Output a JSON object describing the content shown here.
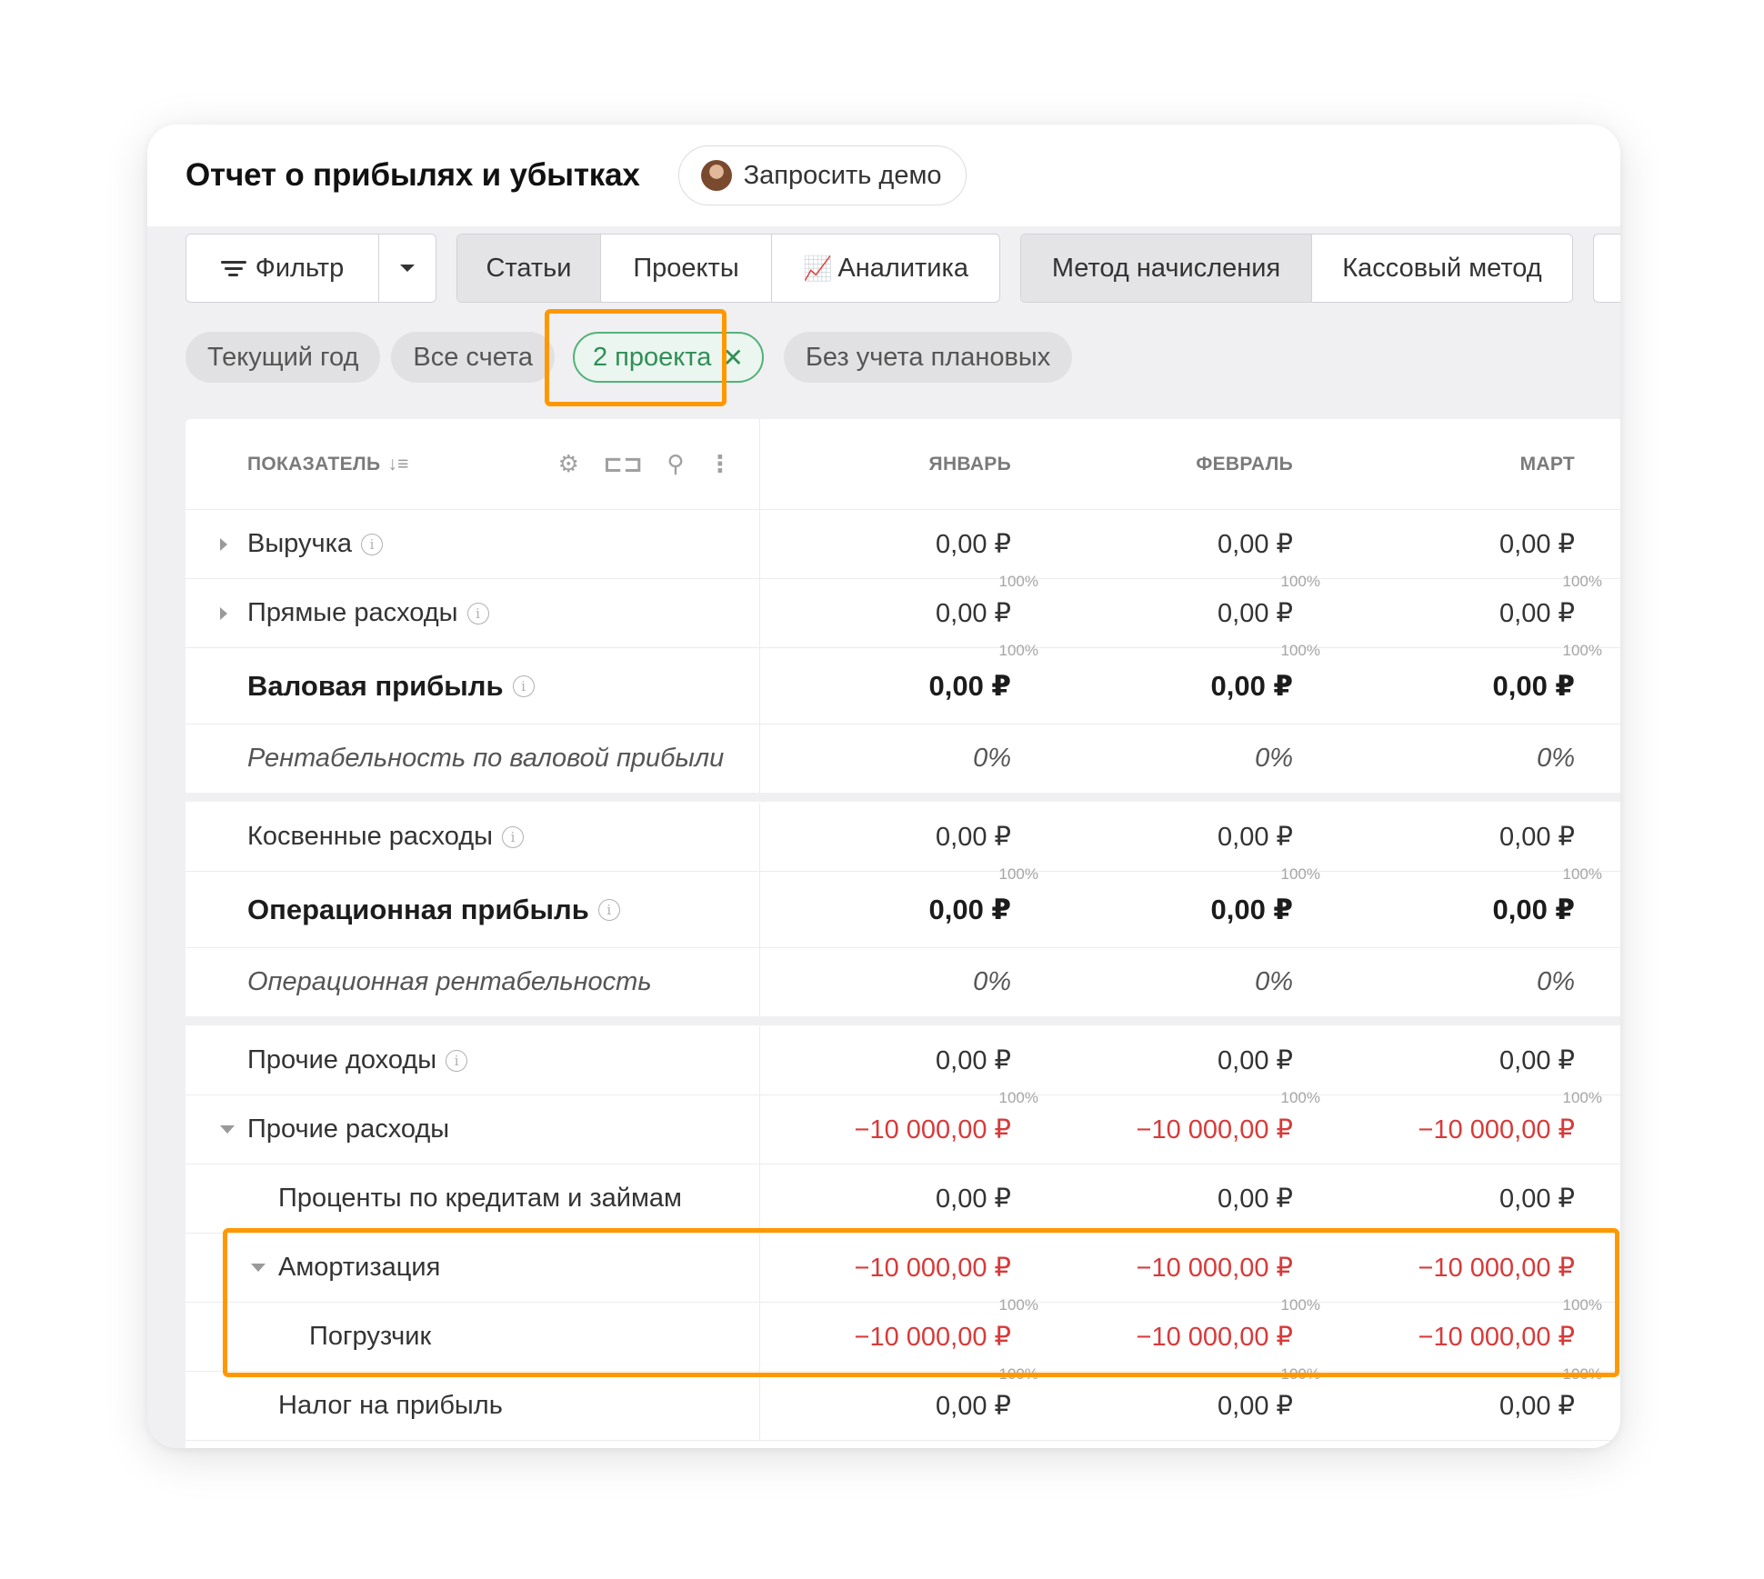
{
  "header": {
    "title": "Отчет о прибылях и убытках",
    "demo_button": "Запросить демо"
  },
  "toolbar": {
    "filter_label": "Фильтр",
    "view_tabs": [
      "Статьи",
      "Проекты",
      "Аналитика"
    ],
    "method_tabs": [
      "Метод начисления",
      "Кассовый метод"
    ]
  },
  "chips": {
    "period": "Текущий год",
    "accounts": "Все счета",
    "projects": "2 проекта",
    "planned": "Без учета плановых",
    "close_glyph": "✕"
  },
  "table": {
    "header_label": "ПОКАЗАТЕЛЬ",
    "sort_glyph": "↓≡",
    "columns": [
      "ЯНВАРЬ",
      "ФЕВРАЛЬ",
      "МАРТ"
    ],
    "info_glyph": "i",
    "rows": [
      {
        "label": "Выручка",
        "values": [
          "0,00 ₽",
          "0,00 ₽",
          "0,00 ₽"
        ],
        "pcts": [
          "100%",
          "100%",
          "100%"
        ]
      },
      {
        "label": "Прямые расходы",
        "values": [
          "0,00 ₽",
          "0,00 ₽",
          "0,00 ₽"
        ],
        "pcts": [
          "100%",
          "100%",
          "100%"
        ]
      },
      {
        "label": "Валовая прибыль",
        "values": [
          "0,00 ₽",
          "0,00 ₽",
          "0,00 ₽"
        ]
      },
      {
        "label": "Рентабельность по валовой прибыли",
        "values": [
          "0%",
          "0%",
          "0%"
        ]
      },
      {
        "label": "Косвенные расходы",
        "values": [
          "0,00 ₽",
          "0,00 ₽",
          "0,00 ₽"
        ],
        "pcts": [
          "100%",
          "100%",
          "100%"
        ]
      },
      {
        "label": "Операционная прибыль",
        "values": [
          "0,00 ₽",
          "0,00 ₽",
          "0,00 ₽"
        ]
      },
      {
        "label": "Операционная рентабельность",
        "values": [
          "0%",
          "0%",
          "0%"
        ]
      },
      {
        "label": "Прочие доходы",
        "values": [
          "0,00 ₽",
          "0,00 ₽",
          "0,00 ₽"
        ],
        "pcts": [
          "100%",
          "100%",
          "100%"
        ]
      },
      {
        "label": "Прочие расходы",
        "values": [
          "−10 000,00 ₽",
          "−10 000,00 ₽",
          "−10 000,00 ₽"
        ]
      },
      {
        "label": "Проценты по кредитам и займам",
        "values": [
          "0,00 ₽",
          "0,00 ₽",
          "0,00 ₽"
        ]
      },
      {
        "label": "Амортизация",
        "values": [
          "−10 000,00 ₽",
          "−10 000,00 ₽",
          "−10 000,00 ₽"
        ],
        "pcts": [
          "100%",
          "100%",
          "100%"
        ]
      },
      {
        "label": "Погрузчик",
        "values": [
          "−10 000,00 ₽",
          "−10 000,00 ₽",
          "−10 000,00 ₽"
        ],
        "pcts": [
          "100%",
          "100%",
          "100%"
        ]
      },
      {
        "label": "Налог на прибыль",
        "values": [
          "0,00 ₽",
          "0,00 ₽",
          "0,00 ₽"
        ]
      }
    ]
  },
  "colors": {
    "highlight": "#ff9800",
    "negative": "#d83a3a",
    "chip_active": "#2f8f57"
  }
}
